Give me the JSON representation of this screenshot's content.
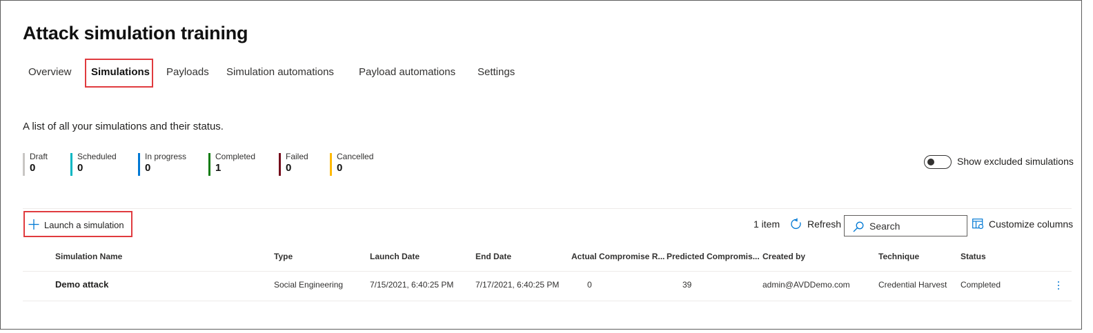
{
  "page": {
    "title": "Attack simulation training",
    "description": "A list of all your simulations and their status."
  },
  "tabs": [
    {
      "label": "Overview",
      "active": false
    },
    {
      "label": "Simulations",
      "active": true
    },
    {
      "label": "Payloads",
      "active": false
    },
    {
      "label": "Simulation automations",
      "active": false
    },
    {
      "label": "Payload automations",
      "active": false
    },
    {
      "label": "Settings",
      "active": false
    }
  ],
  "stats": [
    {
      "label": "Draft",
      "value": "0",
      "color": "#c8c6c4"
    },
    {
      "label": "Scheduled",
      "value": "0",
      "color": "#00b7c3"
    },
    {
      "label": "In progress",
      "value": "0",
      "color": "#0078d4"
    },
    {
      "label": "Completed",
      "value": "1",
      "color": "#107c10"
    },
    {
      "label": "Failed",
      "value": "0",
      "color": "#750b1c"
    },
    {
      "label": "Cancelled",
      "value": "0",
      "color": "#ffb900"
    }
  ],
  "toggle": {
    "label": "Show excluded simulations",
    "on": false
  },
  "toolbar": {
    "launch_label": "Launch a simulation",
    "item_count": "1 item",
    "refresh_label": "Refresh",
    "search_placeholder": "Search",
    "customize_label": "Customize columns"
  },
  "table": {
    "columns": [
      "Simulation Name",
      "Type",
      "Launch Date",
      "End Date",
      "Actual Compromise R...",
      "Predicted Compromis...",
      "Created by",
      "Technique",
      "Status"
    ],
    "rows": [
      {
        "name": "Demo attack",
        "type": "Social Engineering",
        "launch_date": "7/15/2021, 6:40:25 PM",
        "end_date": "7/17/2021, 6:40:25 PM",
        "actual": "0",
        "predicted": "39",
        "created_by": "admin@AVDDemo.com",
        "technique": "Credential Harvest",
        "status": "Completed"
      }
    ]
  },
  "icons": {
    "plus": "plus-icon",
    "refresh": "refresh-icon",
    "search": "search-icon",
    "customize": "customize-columns-icon",
    "more": "more-vertical-icon"
  },
  "colors": {
    "accent": "#0078d4",
    "highlight": "#e03a3e"
  }
}
